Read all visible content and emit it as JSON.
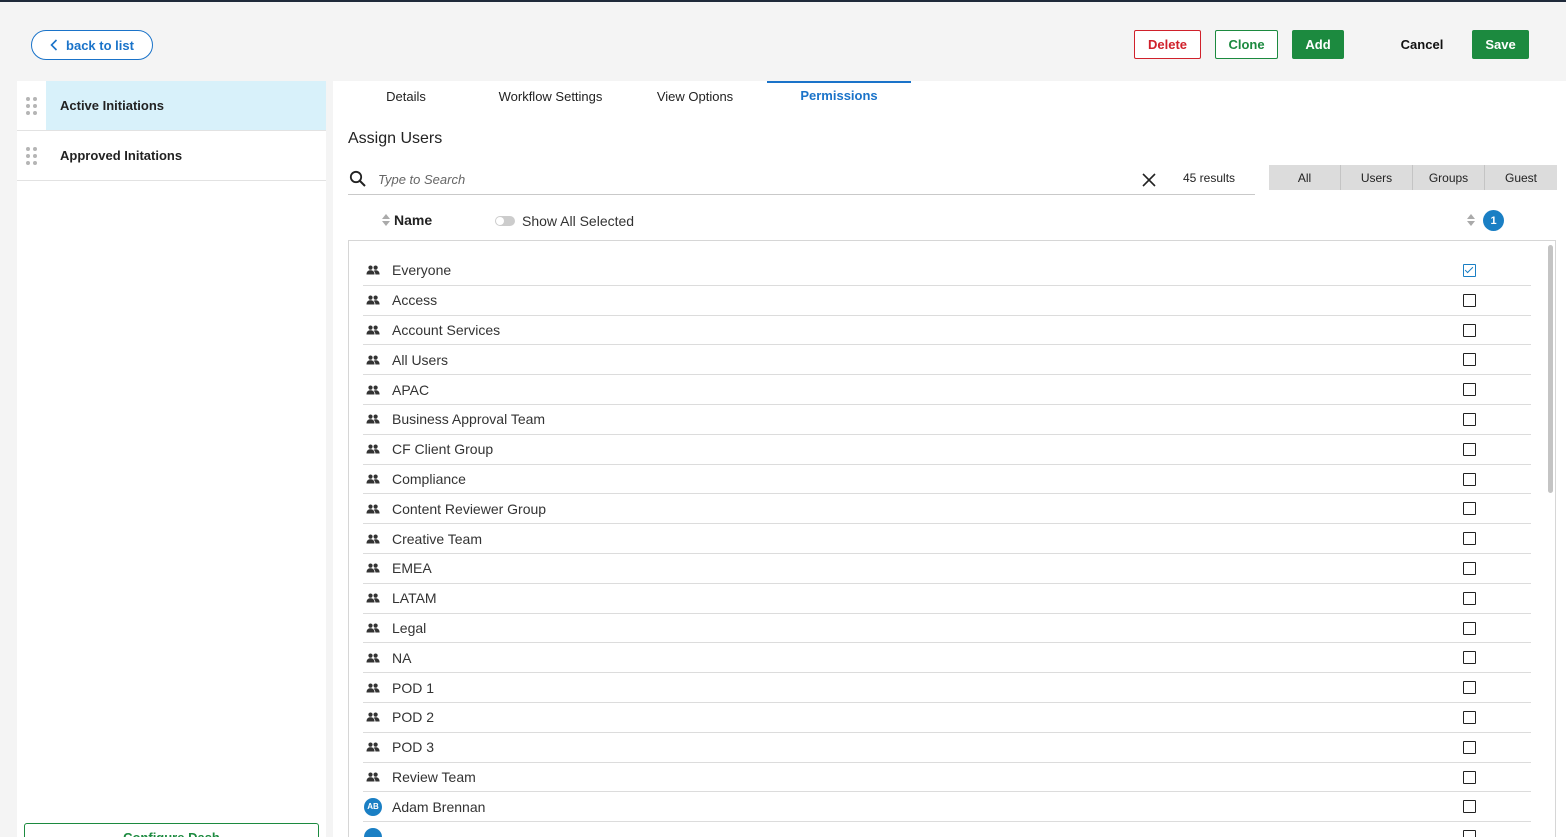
{
  "header": {
    "back_label": "back to list",
    "delete_label": "Delete",
    "clone_label": "Clone",
    "add_label": "Add",
    "cancel_label": "Cancel",
    "save_label": "Save"
  },
  "sidebar": {
    "items": [
      {
        "label": "Active Initiations",
        "active": true
      },
      {
        "label": "Approved Initations",
        "active": false
      }
    ],
    "configure_label": "Configure Dash"
  },
  "tabs": [
    "Details",
    "Workflow Settings",
    "View Options",
    "Permissions"
  ],
  "active_tab": "Permissions",
  "section_title": "Assign Users",
  "search": {
    "placeholder": "Type to Search",
    "value": "",
    "results": "45 results"
  },
  "filters": [
    "All",
    "Users",
    "Groups",
    "Guest"
  ],
  "columns": {
    "name": "Name",
    "show_all_selected": "Show All Selected",
    "selected_count": "1"
  },
  "rows": [
    {
      "name": "Everyone",
      "type": "group",
      "checked": true
    },
    {
      "name": "Access",
      "type": "group",
      "checked": false
    },
    {
      "name": "Account Services",
      "type": "group",
      "checked": false
    },
    {
      "name": "All Users",
      "type": "group",
      "checked": false
    },
    {
      "name": "APAC",
      "type": "group",
      "checked": false
    },
    {
      "name": "Business Approval Team",
      "type": "group",
      "checked": false
    },
    {
      "name": "CF Client Group",
      "type": "group",
      "checked": false
    },
    {
      "name": "Compliance",
      "type": "group",
      "checked": false
    },
    {
      "name": "Content Reviewer Group",
      "type": "group",
      "checked": false
    },
    {
      "name": "Creative Team",
      "type": "group",
      "checked": false
    },
    {
      "name": "EMEA",
      "type": "group",
      "checked": false
    },
    {
      "name": "LATAM",
      "type": "group",
      "checked": false
    },
    {
      "name": "Legal",
      "type": "group",
      "checked": false
    },
    {
      "name": "NA",
      "type": "group",
      "checked": false
    },
    {
      "name": "POD 1",
      "type": "group",
      "checked": false
    },
    {
      "name": "POD 2",
      "type": "group",
      "checked": false
    },
    {
      "name": "POD 3",
      "type": "group",
      "checked": false
    },
    {
      "name": "Review Team",
      "type": "group",
      "checked": false
    },
    {
      "name": "Adam Brennan",
      "type": "user",
      "initials": "AB",
      "checked": false
    },
    {
      "name": "",
      "type": "user",
      "initials": "",
      "checked": false
    }
  ],
  "colors": {
    "accent_blue": "#1a73c9",
    "green": "#1c8a3f",
    "red": "#d0212b",
    "active_bg": "#d8f1fa"
  }
}
